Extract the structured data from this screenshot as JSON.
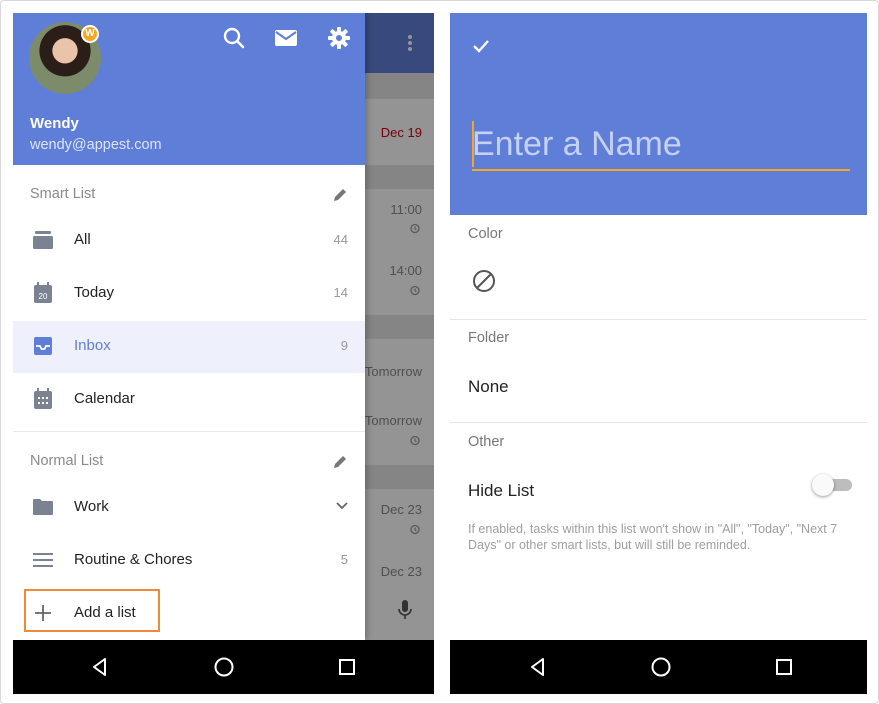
{
  "left_screen": {
    "background_list": {
      "items": [
        {
          "text": "Dec 19",
          "overdue": true
        },
        {
          "text": "11:00",
          "alarm": true
        },
        {
          "text": "14:00",
          "alarm": true
        },
        {
          "text": "Tomorrow",
          "alarm": false
        },
        {
          "text": "Tomorrow",
          "alarm": true
        },
        {
          "text": "Dec 23",
          "alarm": true
        },
        {
          "text": "Dec 23",
          "alarm": false
        }
      ]
    },
    "drawer": {
      "user": {
        "name": "Wendy",
        "email": "wendy@appest.com",
        "badge": "W"
      },
      "header_icons": [
        "search-icon",
        "mail-icon",
        "settings-icon"
      ],
      "smart_list": {
        "title": "Smart List",
        "items": [
          {
            "label": "All",
            "count": "44",
            "icon": "all-list-icon"
          },
          {
            "label": "Today",
            "count": "14",
            "icon": "today-calendar-icon",
            "day": "20"
          },
          {
            "label": "Inbox",
            "count": "9",
            "icon": "inbox-icon",
            "active": true
          },
          {
            "label": "Calendar",
            "count": "",
            "icon": "calendar-icon"
          }
        ]
      },
      "normal_list": {
        "title": "Normal List",
        "items": [
          {
            "label": "Work",
            "icon": "folder-icon",
            "expand": "chevron-down-icon"
          },
          {
            "label": "Routine & Chores",
            "count": "5",
            "icon": "list-icon"
          }
        ]
      },
      "add_list": {
        "label": "Add a list",
        "icon": "plus-icon",
        "highlight_color": "#f08a3a"
      }
    }
  },
  "right_screen": {
    "header": {
      "confirm_icon": "check-icon",
      "name_placeholder": "Enter a Name"
    },
    "color": {
      "label": "Color",
      "value_icon": "no-color-icon"
    },
    "folder": {
      "label": "Folder",
      "value": "None"
    },
    "other": {
      "label": "Other",
      "hide_list": {
        "label": "Hide List",
        "enabled": false
      },
      "help_text": "If enabled, tasks within this list won't show in \"All\", \"Today\", \"Next 7 Days\" or other smart lists, but will still be reminded."
    }
  },
  "colors": {
    "accent": "#5f7ed8",
    "highlight": "#f5a623",
    "overdue": "#d0021b",
    "navbar": "#000000"
  }
}
